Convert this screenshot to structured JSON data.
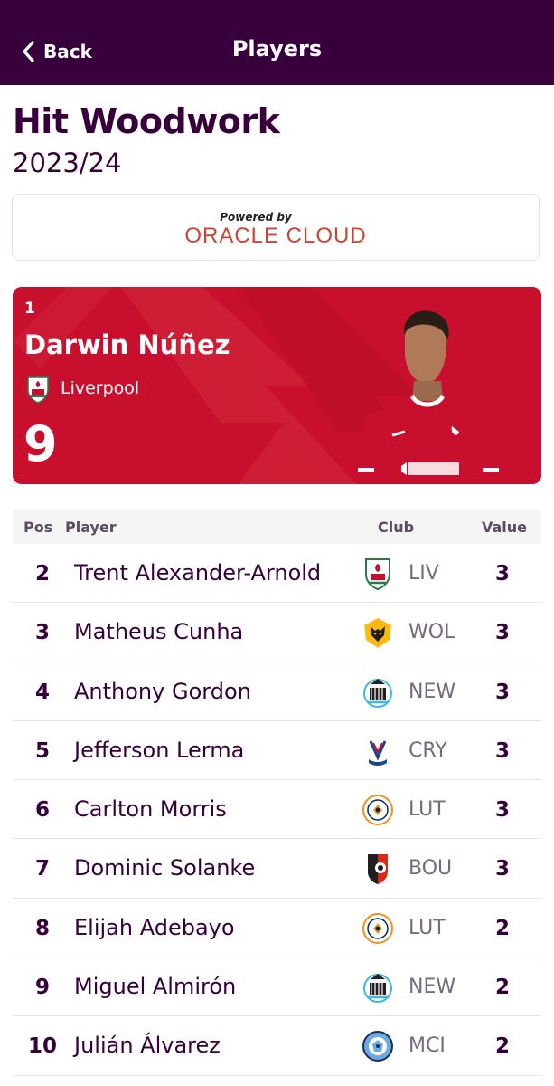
{
  "nav": {
    "back_label": "Back",
    "title": "Players"
  },
  "page": {
    "title": "Hit Woodwork",
    "season": "2023/24"
  },
  "sponsor": {
    "powered_by": "Powered by",
    "brand": "ORACLE CLOUD",
    "brand_color": "#c74634"
  },
  "leader": {
    "rank": "1",
    "name": "Darwin Núñez",
    "club": "Liverpool",
    "club_crest_icon": "liverpool-crest-icon",
    "value": "9",
    "card_color": "#c8102e"
  },
  "table": {
    "headers": {
      "pos": "Pos",
      "player": "Player",
      "club": "Club",
      "value": "Value"
    },
    "rows": [
      {
        "pos": "2",
        "player": "Trent Alexander-Arnold",
        "club": "LIV",
        "crest_icon": "liverpool-crest-icon",
        "value": "3"
      },
      {
        "pos": "3",
        "player": "Matheus Cunha",
        "club": "WOL",
        "crest_icon": "wolves-crest-icon",
        "value": "3"
      },
      {
        "pos": "4",
        "player": "Anthony Gordon",
        "club": "NEW",
        "crest_icon": "newcastle-crest-icon",
        "value": "3"
      },
      {
        "pos": "5",
        "player": "Jefferson Lerma",
        "club": "CRY",
        "crest_icon": "crystal-palace-crest-icon",
        "value": "3"
      },
      {
        "pos": "6",
        "player": "Carlton Morris",
        "club": "LUT",
        "crest_icon": "luton-crest-icon",
        "value": "3"
      },
      {
        "pos": "7",
        "player": "Dominic Solanke",
        "club": "BOU",
        "crest_icon": "bournemouth-crest-icon",
        "value": "3"
      },
      {
        "pos": "8",
        "player": "Elijah Adebayo",
        "club": "LUT",
        "crest_icon": "luton-crest-icon",
        "value": "2"
      },
      {
        "pos": "9",
        "player": "Miguel Almirón",
        "club": "NEW",
        "crest_icon": "newcastle-crest-icon",
        "value": "2"
      },
      {
        "pos": "10",
        "player": "Julián Álvarez",
        "club": "MCI",
        "crest_icon": "man-city-crest-icon",
        "value": "2"
      }
    ]
  },
  "colors": {
    "primary": "#37003c",
    "header_bg": "#37003c",
    "row_divider": "#e4e4e4",
    "muted_text": "#786a7d"
  }
}
